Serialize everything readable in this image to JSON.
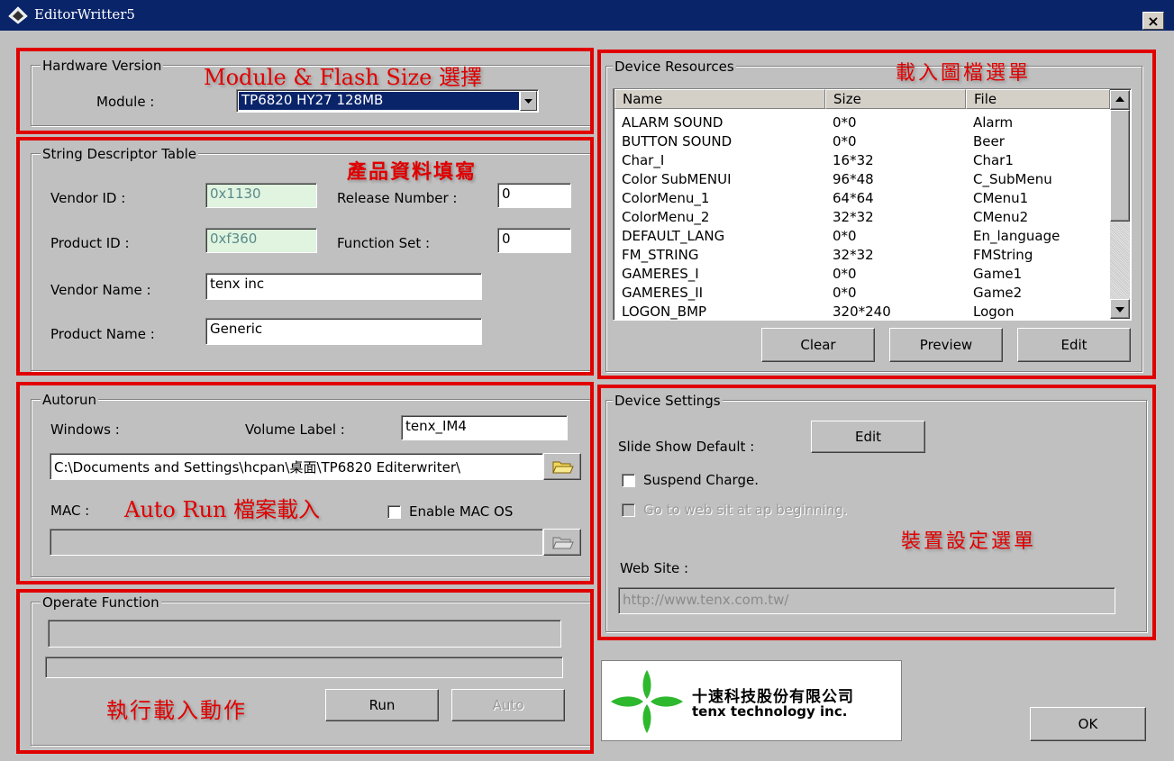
{
  "window": {
    "title": "EditorWritter5",
    "close_label": "×"
  },
  "hardware": {
    "legend": "Hardware Version",
    "module_label": "Module :",
    "module_value": "TP6820 HY27 128MB",
    "annotation": "Module & Flash Size 選擇"
  },
  "string_table": {
    "legend": "String Descriptor Table",
    "annotation": "產品資料填寫",
    "vendor_id_label": "Vendor ID :",
    "vendor_id": "0x1130",
    "product_id_label": "Product ID :",
    "product_id": "0xf360",
    "release_label": "Release Number :",
    "release_value": "0",
    "function_label": "Function Set :",
    "function_value": "0",
    "vendor_name_label": "Vendor Name :",
    "vendor_name": "tenx inc",
    "product_name_label": "Product Name :",
    "product_name": "Generic"
  },
  "autorun": {
    "legend": "Autorun",
    "windows_label": "Windows :",
    "volume_label": "Volume Label :",
    "volume_value": "tenx_IM4",
    "windows_path": "C:\\Documents and Settings\\hcpan\\桌面\\TP6820 Editerwriter\\",
    "mac_label": "MAC :",
    "annotation": "Auto Run 檔案載入",
    "enable_mac_label": "Enable MAC OS",
    "mac_path": ""
  },
  "operate": {
    "legend": "Operate Function",
    "annotation": "執行載入動作",
    "run_label": "Run",
    "auto_label": "Auto"
  },
  "resources": {
    "legend": "Device Resources",
    "annotation": "載入圖檔選單",
    "columns": [
      "Name",
      "Size",
      "File"
    ],
    "rows": [
      [
        "ALARM SOUND",
        "0*0",
        "Alarm"
      ],
      [
        "BUTTON SOUND",
        "0*0",
        "Beer"
      ],
      [
        "Char_I",
        "16*32",
        "Char1"
      ],
      [
        "Color SubMENUI",
        "96*48",
        "C_SubMenu"
      ],
      [
        "ColorMenu_1",
        "64*64",
        "CMenu1"
      ],
      [
        "ColorMenu_2",
        "32*32",
        "CMenu2"
      ],
      [
        "DEFAULT_LANG",
        "0*0",
        "En_language"
      ],
      [
        "FM_STRING",
        "32*32",
        "FMString"
      ],
      [
        "GAMERES_I",
        "0*0",
        "Game1"
      ],
      [
        "GAMERES_II",
        "0*0",
        "Game2"
      ],
      [
        "LOGON_BMP",
        "320*240",
        "Logon"
      ]
    ],
    "clear_label": "Clear",
    "preview_label": "Preview",
    "edit_label": "Edit"
  },
  "settings": {
    "legend": "Device Settings",
    "slide_label": "Slide Show Default :",
    "edit_label": "Edit",
    "suspend_label": "Suspend Charge.",
    "goto_label": "Go to web sit at ap beginning.",
    "annotation": "裝置設定選單",
    "website_label": "Web Site :",
    "website_value": "http://www.tenx.com.tw/"
  },
  "logo": {
    "chinese": "十速科技股份有限公司",
    "english": "tenx technology inc."
  },
  "ok_label": "OK",
  "colors": {
    "annotation": "#e00000",
    "titlebar": "#0a246a",
    "logo_green": "#2eb82e"
  }
}
